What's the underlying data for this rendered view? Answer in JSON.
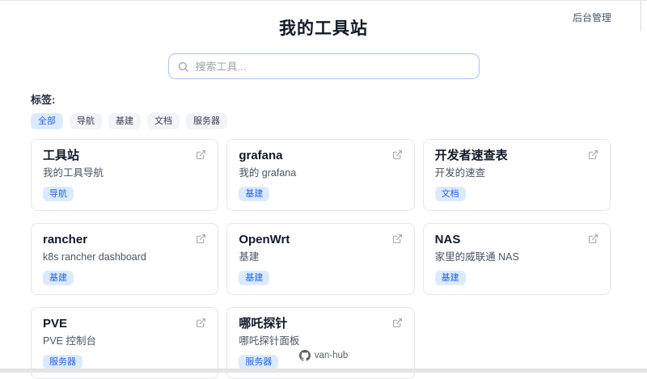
{
  "header": {
    "title": "我的工具站",
    "admin_link": "后台管理"
  },
  "search": {
    "placeholder": "搜索工具..."
  },
  "tags": {
    "label": "标签:",
    "items": [
      {
        "label": "全部",
        "active": true
      },
      {
        "label": "导航",
        "active": false
      },
      {
        "label": "基建",
        "active": false
      },
      {
        "label": "文档",
        "active": false
      },
      {
        "label": "服务器",
        "active": false
      }
    ]
  },
  "cards": [
    {
      "title": "工具站",
      "description": "我的工具导航",
      "tag": "导航"
    },
    {
      "title": "grafana",
      "description": "我的 grafana",
      "tag": "基建"
    },
    {
      "title": "开发者速查表",
      "description": "开发的速查",
      "tag": "文档"
    },
    {
      "title": "rancher",
      "description": "k8s rancher dashboard",
      "tag": "基建"
    },
    {
      "title": "OpenWrt",
      "description": "基建",
      "tag": "基建"
    },
    {
      "title": "NAS",
      "description": "家里的威联通 NAS",
      "tag": "基建"
    },
    {
      "title": "PVE",
      "description": "PVE 控制台",
      "tag": "服务器"
    },
    {
      "title": "哪吒探针",
      "description": "哪吒探针面板",
      "tag": "服务器"
    }
  ],
  "footer": {
    "label": "van-hub"
  },
  "colors": {
    "accent": "#2563eb",
    "accent_bg": "#dbeafe",
    "search_border": "#a8c4f8",
    "card_border": "#e5e7eb",
    "muted_text": "#4b5563",
    "pill_bg": "#f3f4f6"
  }
}
